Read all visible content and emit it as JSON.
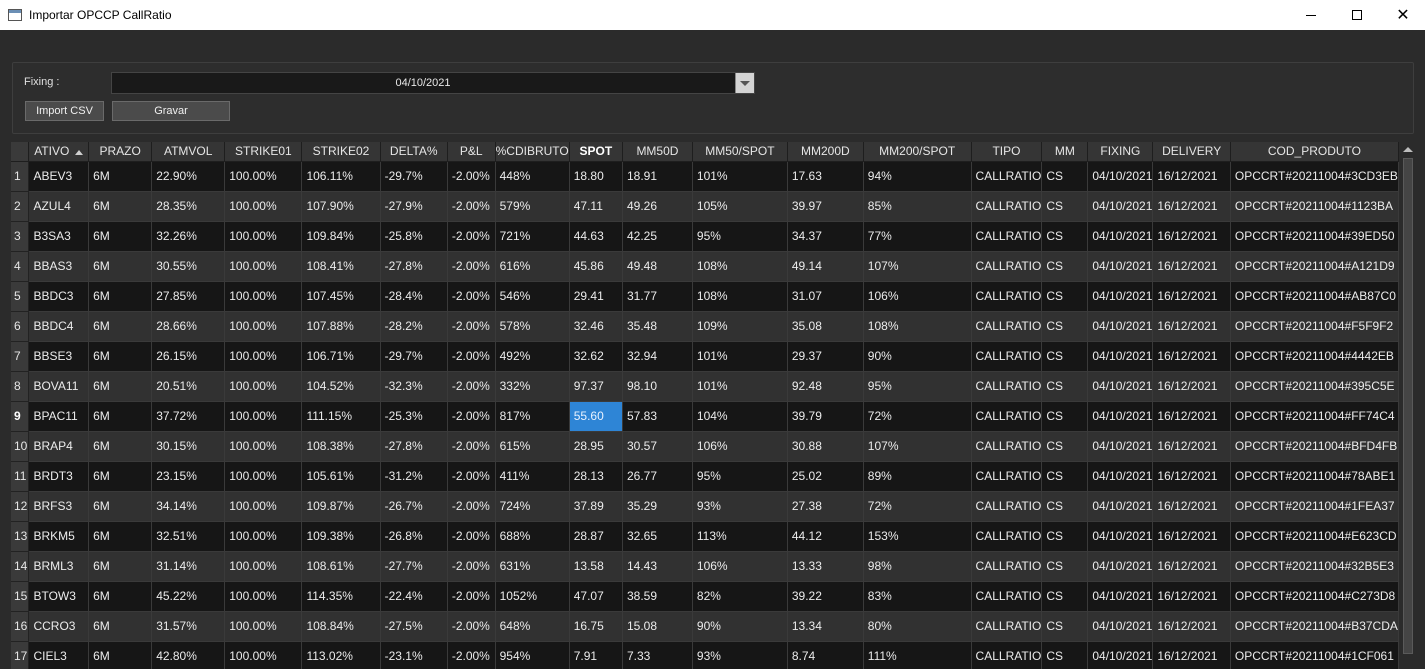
{
  "window": {
    "title": "Importar OPCCP CallRatio"
  },
  "fixing": {
    "label": "Fixing :",
    "value": "04/10/2021"
  },
  "buttons": {
    "import": "Import CSV",
    "save": "Gravar"
  },
  "columns": [
    "ATIVO",
    "PRAZO",
    "ATMVOL",
    "STRIKE01",
    "STRIKE02",
    "DELTA%",
    "P&L",
    "%CDIBRUTO",
    "SPOT",
    "MM50D",
    "MM50/SPOT",
    "MM200D",
    "MM200/SPOT",
    "TIPO",
    "MM",
    "FIXING",
    "DELIVERY",
    "COD_PRODUTO"
  ],
  "sorted_column": "ATIVO",
  "selected_cell": {
    "row": 9,
    "column": "SPOT"
  },
  "rows": [
    [
      "ABEV3",
      "6M",
      "22.90%",
      "100.00%",
      "106.11%",
      "-29.7%",
      "-2.00%",
      "448%",
      "18.80",
      "18.91",
      "101%",
      "17.63",
      "94%",
      "CALLRATIO",
      "CS",
      "04/10/2021",
      "16/12/2021",
      "OPCCRT#20211004#3CD3EB"
    ],
    [
      "AZUL4",
      "6M",
      "28.35%",
      "100.00%",
      "107.90%",
      "-27.9%",
      "-2.00%",
      "579%",
      "47.11",
      "49.26",
      "105%",
      "39.97",
      "85%",
      "CALLRATIO",
      "CS",
      "04/10/2021",
      "16/12/2021",
      "OPCCRT#20211004#1123BA"
    ],
    [
      "B3SA3",
      "6M",
      "32.26%",
      "100.00%",
      "109.84%",
      "-25.8%",
      "-2.00%",
      "721%",
      "44.63",
      "42.25",
      "95%",
      "34.37",
      "77%",
      "CALLRATIO",
      "CS",
      "04/10/2021",
      "16/12/2021",
      "OPCCRT#20211004#39ED50"
    ],
    [
      "BBAS3",
      "6M",
      "30.55%",
      "100.00%",
      "108.41%",
      "-27.8%",
      "-2.00%",
      "616%",
      "45.86",
      "49.48",
      "108%",
      "49.14",
      "107%",
      "CALLRATIO",
      "CS",
      "04/10/2021",
      "16/12/2021",
      "OPCCRT#20211004#A121D9"
    ],
    [
      "BBDC3",
      "6M",
      "27.85%",
      "100.00%",
      "107.45%",
      "-28.4%",
      "-2.00%",
      "546%",
      "29.41",
      "31.77",
      "108%",
      "31.07",
      "106%",
      "CALLRATIO",
      "CS",
      "04/10/2021",
      "16/12/2021",
      "OPCCRT#20211004#AB87C0"
    ],
    [
      "BBDC4",
      "6M",
      "28.66%",
      "100.00%",
      "107.88%",
      "-28.2%",
      "-2.00%",
      "578%",
      "32.46",
      "35.48",
      "109%",
      "35.08",
      "108%",
      "CALLRATIO",
      "CS",
      "04/10/2021",
      "16/12/2021",
      "OPCCRT#20211004#F5F9F2"
    ],
    [
      "BBSE3",
      "6M",
      "26.15%",
      "100.00%",
      "106.71%",
      "-29.7%",
      "-2.00%",
      "492%",
      "32.62",
      "32.94",
      "101%",
      "29.37",
      "90%",
      "CALLRATIO",
      "CS",
      "04/10/2021",
      "16/12/2021",
      "OPCCRT#20211004#4442EB"
    ],
    [
      "BOVA11",
      "6M",
      "20.51%",
      "100.00%",
      "104.52%",
      "-32.3%",
      "-2.00%",
      "332%",
      "97.37",
      "98.10",
      "101%",
      "92.48",
      "95%",
      "CALLRATIO",
      "CS",
      "04/10/2021",
      "16/12/2021",
      "OPCCRT#20211004#395C5E"
    ],
    [
      "BPAC11",
      "6M",
      "37.72%",
      "100.00%",
      "111.15%",
      "-25.3%",
      "-2.00%",
      "817%",
      "55.60",
      "57.83",
      "104%",
      "39.79",
      "72%",
      "CALLRATIO",
      "CS",
      "04/10/2021",
      "16/12/2021",
      "OPCCRT#20211004#FF74C4"
    ],
    [
      "BRAP4",
      "6M",
      "30.15%",
      "100.00%",
      "108.38%",
      "-27.8%",
      "-2.00%",
      "615%",
      "28.95",
      "30.57",
      "106%",
      "30.88",
      "107%",
      "CALLRATIO",
      "CS",
      "04/10/2021",
      "16/12/2021",
      "OPCCRT#20211004#BFD4FB"
    ],
    [
      "BRDT3",
      "6M",
      "23.15%",
      "100.00%",
      "105.61%",
      "-31.2%",
      "-2.00%",
      "411%",
      "28.13",
      "26.77",
      "95%",
      "25.02",
      "89%",
      "CALLRATIO",
      "CS",
      "04/10/2021",
      "16/12/2021",
      "OPCCRT#20211004#78ABE1"
    ],
    [
      "BRFS3",
      "6M",
      "34.14%",
      "100.00%",
      "109.87%",
      "-26.7%",
      "-2.00%",
      "724%",
      "37.89",
      "35.29",
      "93%",
      "27.38",
      "72%",
      "CALLRATIO",
      "CS",
      "04/10/2021",
      "16/12/2021",
      "OPCCRT#20211004#1FEA37"
    ],
    [
      "BRKM5",
      "6M",
      "32.51%",
      "100.00%",
      "109.38%",
      "-26.8%",
      "-2.00%",
      "688%",
      "28.87",
      "32.65",
      "113%",
      "44.12",
      "153%",
      "CALLRATIO",
      "CS",
      "04/10/2021",
      "16/12/2021",
      "OPCCRT#20211004#E623CD"
    ],
    [
      "BRML3",
      "6M",
      "31.14%",
      "100.00%",
      "108.61%",
      "-27.7%",
      "-2.00%",
      "631%",
      "13.58",
      "14.43",
      "106%",
      "13.33",
      "98%",
      "CALLRATIO",
      "CS",
      "04/10/2021",
      "16/12/2021",
      "OPCCRT#20211004#32B5E3"
    ],
    [
      "BTOW3",
      "6M",
      "45.22%",
      "100.00%",
      "114.35%",
      "-22.4%",
      "-2.00%",
      "1052%",
      "47.07",
      "38.59",
      "82%",
      "39.22",
      "83%",
      "CALLRATIO",
      "CS",
      "04/10/2021",
      "16/12/2021",
      "OPCCRT#20211004#C273D8"
    ],
    [
      "CCRO3",
      "6M",
      "31.57%",
      "100.00%",
      "108.84%",
      "-27.5%",
      "-2.00%",
      "648%",
      "16.75",
      "15.08",
      "90%",
      "13.34",
      "80%",
      "CALLRATIO",
      "CS",
      "04/10/2021",
      "16/12/2021",
      "OPCCRT#20211004#B37CDA"
    ],
    [
      "CIEL3",
      "6M",
      "42.80%",
      "100.00%",
      "113.02%",
      "-23.1%",
      "-2.00%",
      "954%",
      "7.91",
      "7.33",
      "93%",
      "8.74",
      "111%",
      "CALLRATIO",
      "CS",
      "04/10/2021",
      "16/12/2021",
      "OPCCRT#20211004#1CF061"
    ]
  ]
}
